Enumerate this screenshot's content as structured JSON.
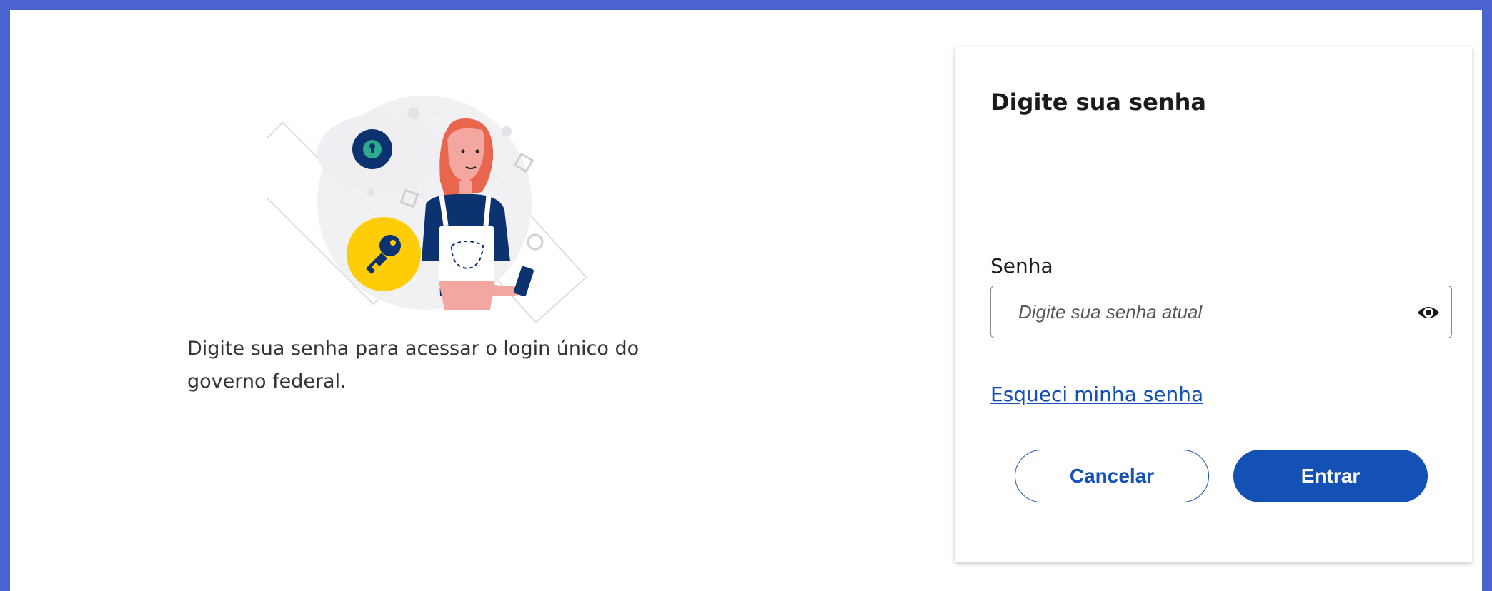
{
  "illustration": {
    "description_text": "Digite sua senha para acessar o login único do governo federal.",
    "icons": [
      "lock-icon",
      "key-icon",
      "person-with-phone-illustration"
    ]
  },
  "card": {
    "title": "Digite sua senha",
    "password_label": "Senha",
    "password_placeholder": "Digite sua senha atual",
    "password_value": "",
    "toggle_icon": "eye-icon",
    "forgot_link": "Esqueci minha senha",
    "cancel_label": "Cancelar",
    "enter_label": "Entrar"
  },
  "colors": {
    "frame_border": "#4a63d0",
    "primary": "#1351b4",
    "key_badge": "#ffcd07",
    "lock_badge": "#0c326f",
    "hair": "#e8664d"
  }
}
